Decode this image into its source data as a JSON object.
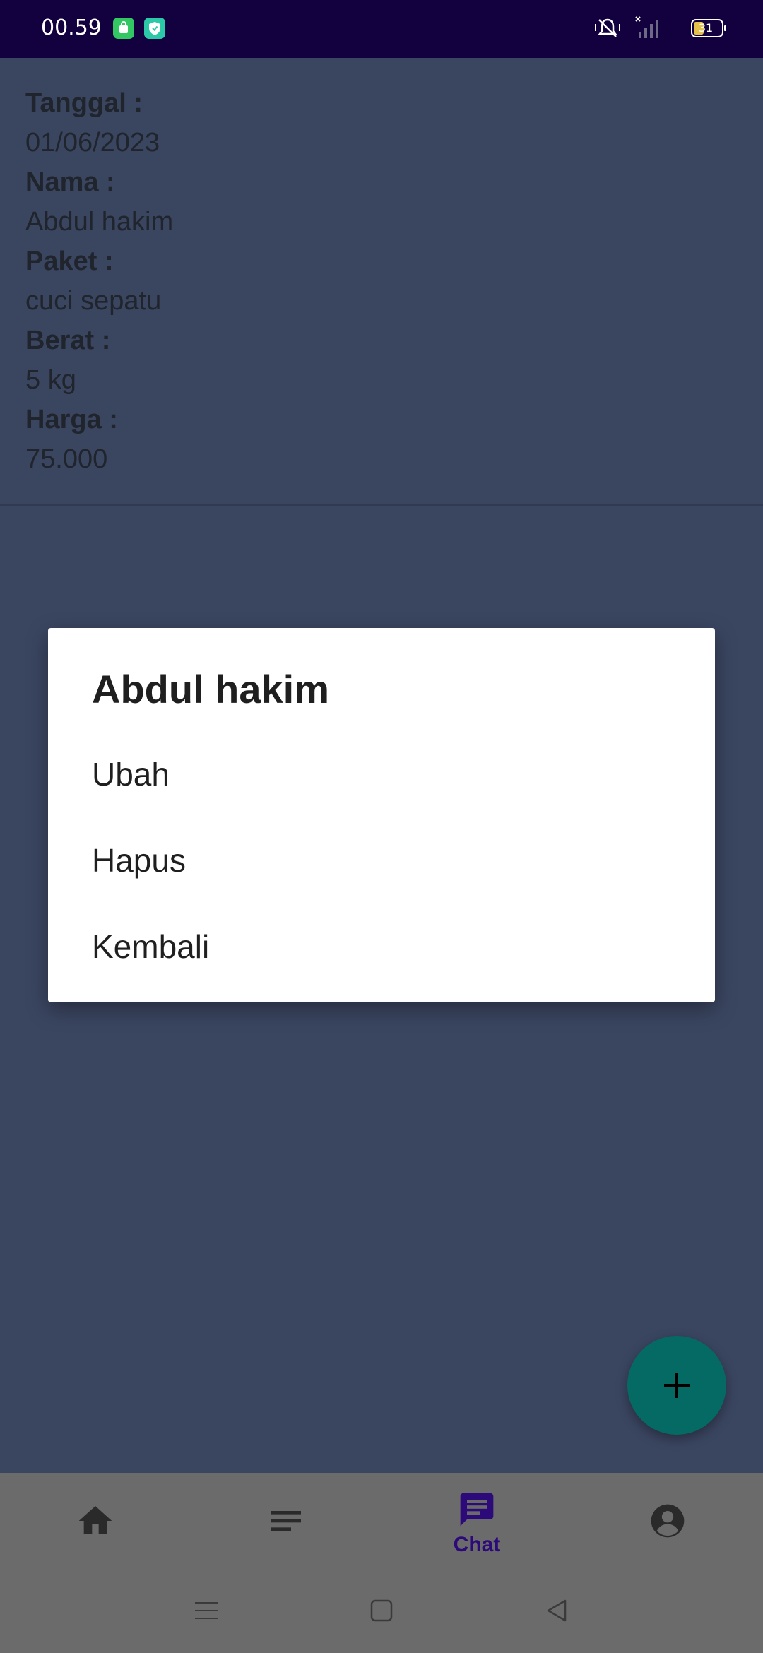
{
  "status_bar": {
    "time": "00.59",
    "battery": "31"
  },
  "detail": {
    "tanggal_label": "Tanggal :",
    "tanggal_value": "01/06/2023",
    "nama_label": "Nama :",
    "nama_value": "Abdul hakim",
    "paket_label": "Paket :",
    "paket_value": "cuci sepatu",
    "berat_label": "Berat :",
    "berat_value": "5 kg",
    "harga_label": "Harga :",
    "harga_value": "75.000"
  },
  "dialog": {
    "title": "Abdul hakim",
    "options": [
      "Ubah",
      "Hapus",
      "Kembali"
    ]
  },
  "bottom_nav": {
    "items": [
      {
        "icon": "home-icon"
      },
      {
        "icon": "list-icon"
      },
      {
        "icon": "chat-icon",
        "label": "Chat",
        "active": true
      },
      {
        "icon": "account-icon"
      }
    ]
  },
  "colors": {
    "status_bar": "#13003f",
    "background_scrim": "#3a4560",
    "fab": "#056a63",
    "active_nav": "#2d0a7a",
    "nav_bar": "#6b6b6b"
  }
}
